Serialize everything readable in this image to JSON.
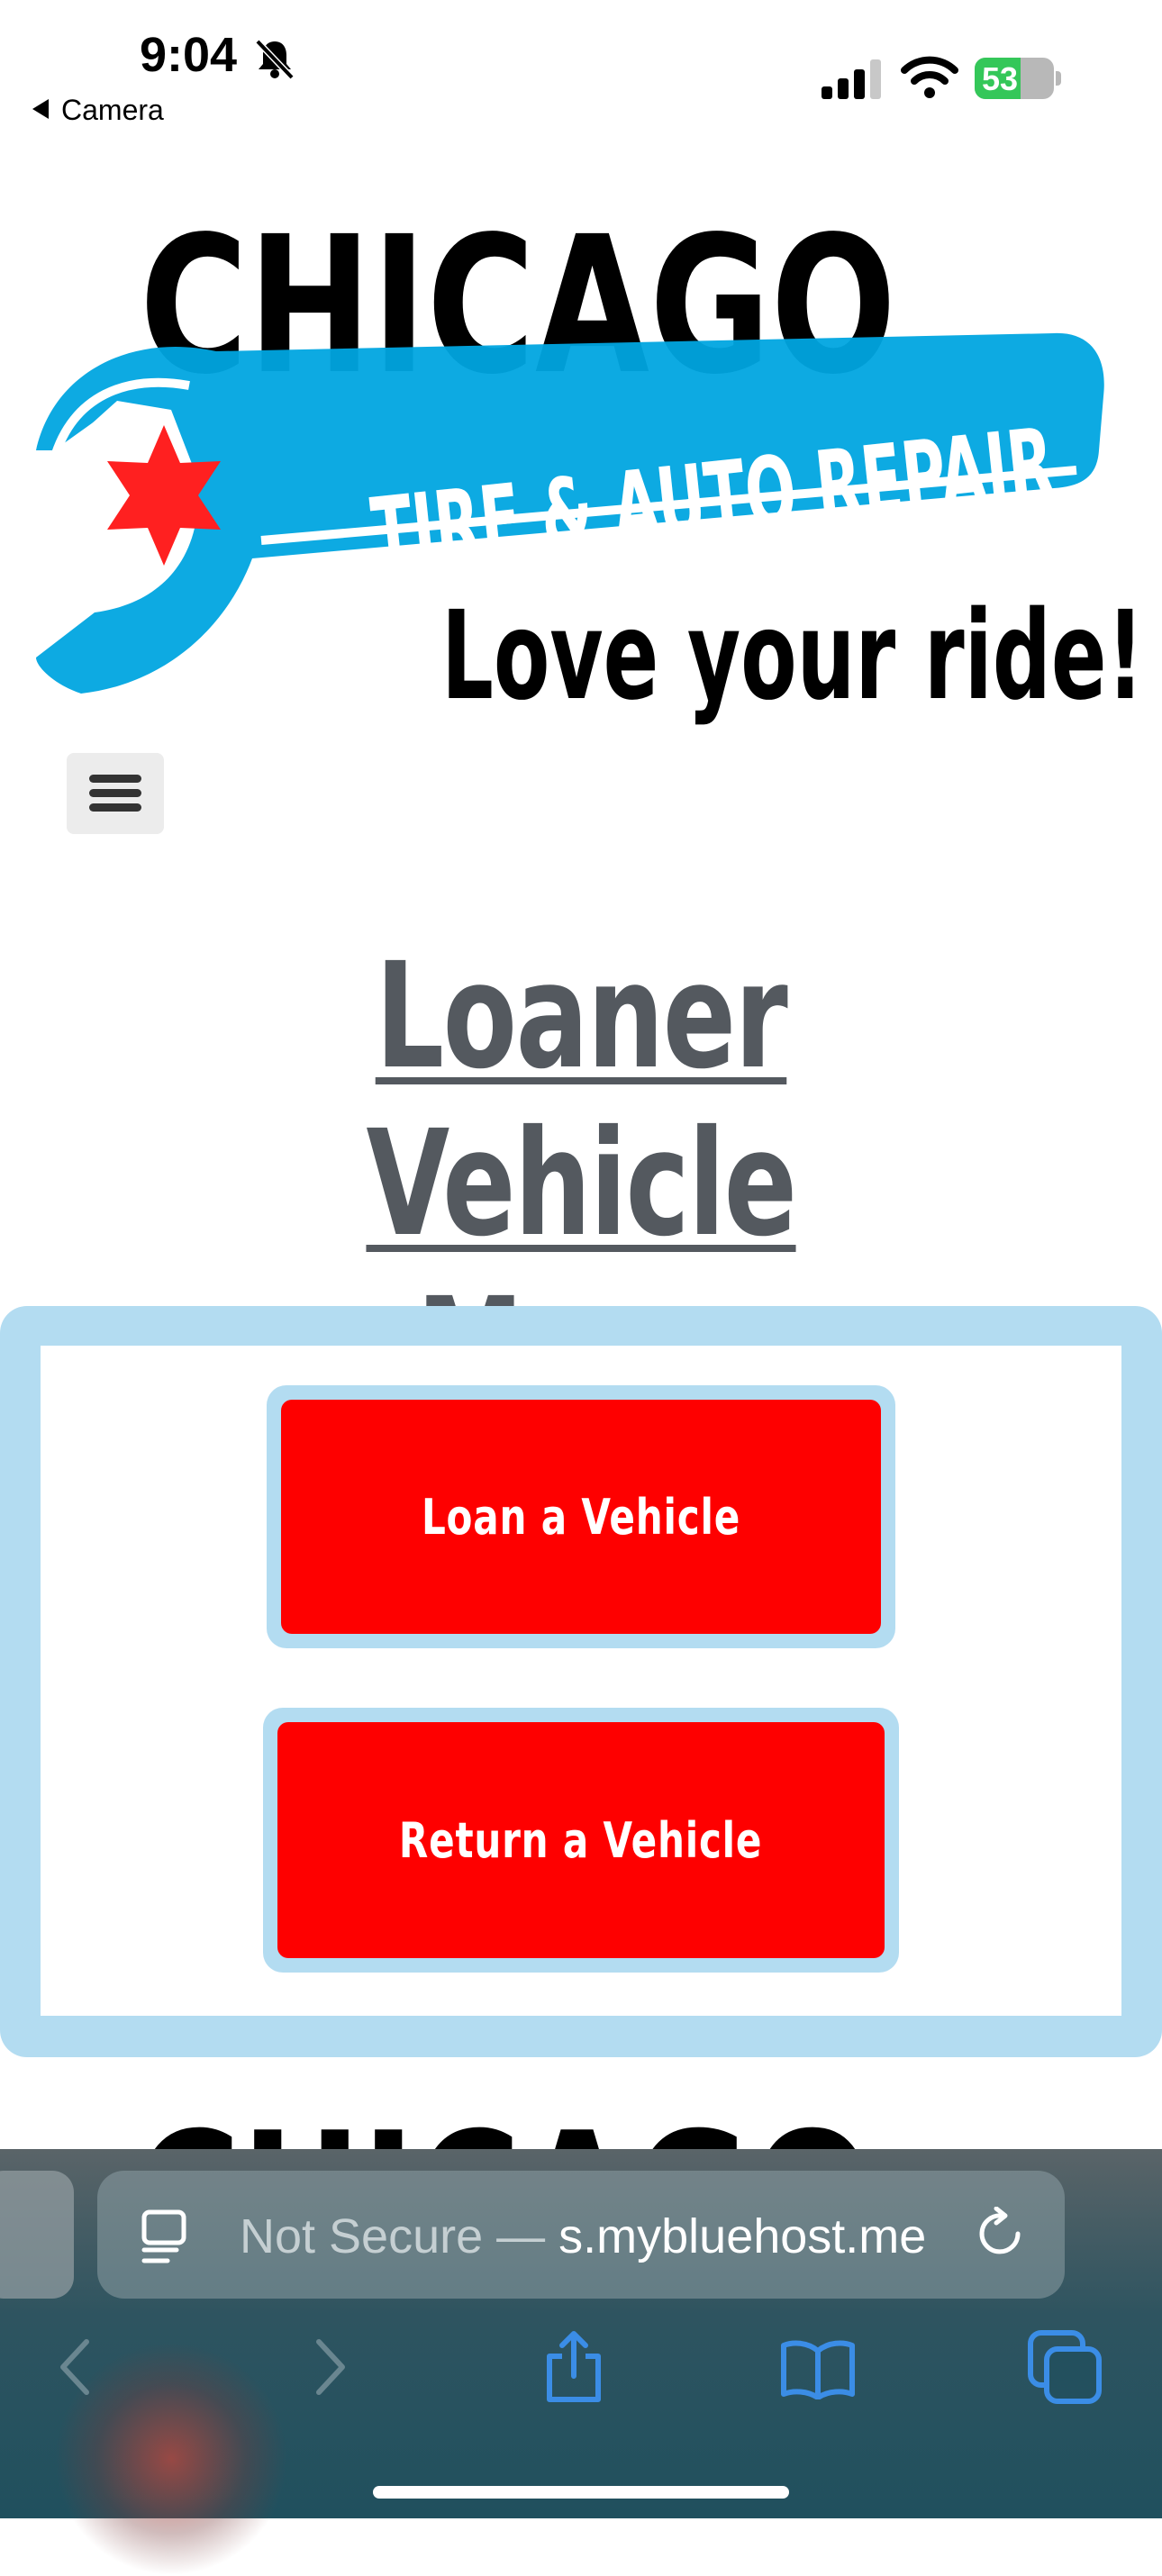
{
  "status_bar": {
    "time": "9:04",
    "back_app": "Camera",
    "battery_percent": "53"
  },
  "logo": {
    "line1": "CHICAGO",
    "line2": "TIRE & AUTO REPAIR",
    "tagline": "Love your ride!"
  },
  "page": {
    "title_line1": "Loaner Vehicle",
    "title_line2": "Menu"
  },
  "actions": {
    "loan_label": "Loan a Vehicle",
    "return_label": "Return a Vehicle"
  },
  "browser": {
    "url_muted": "Not Secure — ",
    "url_host": "s.mybluehost.me"
  },
  "colors": {
    "accent_blue": "#b3dcf1",
    "button_red": "#fe0000",
    "title_gray": "#54595f"
  }
}
